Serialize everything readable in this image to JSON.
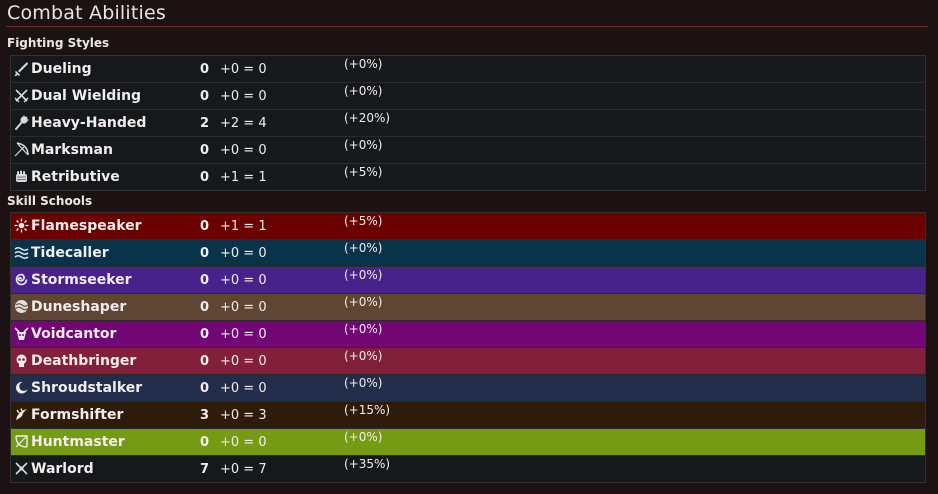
{
  "page": {
    "title": "Combat Abilities"
  },
  "fighting_styles": {
    "heading": "Fighting Styles",
    "row_color": "#16191b",
    "rows": [
      {
        "name": "Dueling",
        "base": "0",
        "bonus": "+0 = 0",
        "pct": "(+0%)",
        "icon": "sword-icon"
      },
      {
        "name": "Dual Wielding",
        "base": "0",
        "bonus": "+0 = 0",
        "pct": "(+0%)",
        "icon": "crossed-swords-icon"
      },
      {
        "name": "Heavy-Handed",
        "base": "2",
        "bonus": "+2 = 4",
        "pct": "(+20%)",
        "icon": "mace-icon"
      },
      {
        "name": "Marksman",
        "base": "0",
        "bonus": "+0 = 0",
        "pct": "(+0%)",
        "icon": "bow-icon"
      },
      {
        "name": "Retributive",
        "base": "0",
        "bonus": "+1 = 1",
        "pct": "(+5%)",
        "icon": "fist-icon"
      }
    ]
  },
  "skill_schools": {
    "heading": "Skill Schools",
    "rows": [
      {
        "name": "Flamespeaker",
        "base": "0",
        "bonus": "+1 = 1",
        "pct": "(+5%)",
        "icon": "flame-icon",
        "color": "#6a0000"
      },
      {
        "name": "Tidecaller",
        "base": "0",
        "bonus": "+0 = 0",
        "pct": "(+0%)",
        "icon": "wave-icon",
        "color": "#083349"
      },
      {
        "name": "Stormseeker",
        "base": "0",
        "bonus": "+0 = 0",
        "pct": "(+0%)",
        "icon": "storm-icon",
        "color": "#47228a"
      },
      {
        "name": "Duneshaper",
        "base": "0",
        "bonus": "+0 = 0",
        "pct": "(+0%)",
        "icon": "dune-icon",
        "color": "#5f4632"
      },
      {
        "name": "Voidcantor",
        "base": "0",
        "bonus": "+0 = 0",
        "pct": "(+0%)",
        "icon": "void-icon",
        "color": "#720674"
      },
      {
        "name": "Deathbringer",
        "base": "0",
        "bonus": "+0 = 0",
        "pct": "(+0%)",
        "icon": "skull-icon",
        "color": "#822039"
      },
      {
        "name": "Shroudstalker",
        "base": "0",
        "bonus": "+0 = 0",
        "pct": "(+0%)",
        "icon": "crescent-icon",
        "color": "#222d4c"
      },
      {
        "name": "Formshifter",
        "base": "3",
        "bonus": "+0 = 3",
        "pct": "(+15%)",
        "icon": "claw-icon",
        "color": "#2f1b09"
      },
      {
        "name": "Huntmaster",
        "base": "0",
        "bonus": "+0 = 0",
        "pct": "(+0%)",
        "icon": "hunt-bow-icon",
        "color": "#759b15"
      },
      {
        "name": "Warlord",
        "base": "7",
        "bonus": "+0 = 7",
        "pct": "(+35%)",
        "icon": "warlord-icon",
        "color": "#16191b"
      }
    ]
  }
}
